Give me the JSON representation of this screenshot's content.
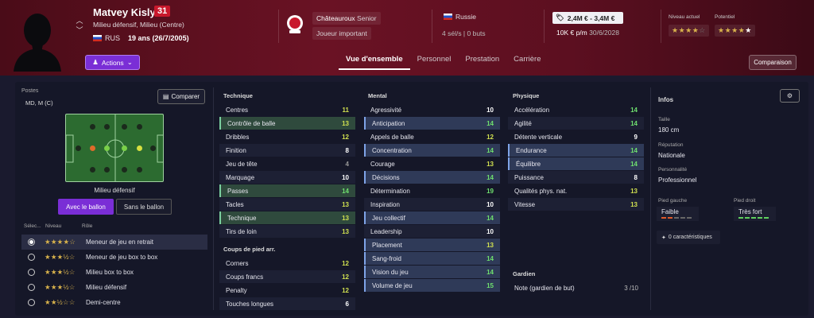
{
  "player": {
    "name": "Matvey Kislyak",
    "number": "31",
    "positions_desc": "Milieu défensif, Milieu (Centre)",
    "nationality_code": "RUS",
    "age_dob": "19 ans (26/7/2005)"
  },
  "header": {
    "actions_label": "Actions",
    "club": "Châteauroux",
    "squad": "Senior",
    "role": "Joueur important",
    "country": "Russie",
    "caps": "4 sél/s | 0 buts",
    "value_range": "2,4M € - 3,4M €",
    "wage": "10K € p/m",
    "contract_end": "30/6/2028",
    "current_level_label": "Niveau actuel",
    "potential_label": "Potentiel",
    "current_stars": 3.5,
    "potential_stars": 4.5,
    "compare_label": "Comparaison"
  },
  "tabs": [
    "Vue d'ensemble",
    "Personnel",
    "Prestation",
    "Carrière"
  ],
  "left": {
    "postes_label": "Postes",
    "positions": "MD, M (C)",
    "compare_label": "Comparer",
    "position_label": "Milieu défensif",
    "with_ball": "Avec le ballon",
    "without_ball": "Sans le ballon",
    "col_select": "Sélec...",
    "col_level": "Niveau",
    "col_role": "Rôle",
    "roles": [
      {
        "stars": "★★★★☆",
        "name": "Meneur de jeu en retrait",
        "selected": true
      },
      {
        "stars": "★★★½☆",
        "name": "Meneur de jeu box to box",
        "selected": false
      },
      {
        "stars": "★★★½☆",
        "name": "Milieu box to box",
        "selected": false
      },
      {
        "stars": "★★★½☆",
        "name": "Milieu défensif",
        "selected": false
      },
      {
        "stars": "★★½☆☆",
        "name": "Demi-centre",
        "selected": false
      }
    ]
  },
  "technique": {
    "title": "Technique",
    "attrs": [
      [
        "Centres",
        "11"
      ],
      [
        "Contrôle de balle",
        "13"
      ],
      [
        "Dribbles",
        "12"
      ],
      [
        "Finition",
        "8"
      ],
      [
        "Jeu de tête",
        "4"
      ],
      [
        "Marquage",
        "10"
      ],
      [
        "Passes",
        "14"
      ],
      [
        "Tacles",
        "13"
      ],
      [
        "Technique",
        "13"
      ],
      [
        "Tirs de loin",
        "13"
      ]
    ]
  },
  "setpieces": {
    "title": "Coups de pied arr.",
    "attrs": [
      [
        "Corners",
        "12"
      ],
      [
        "Coups francs",
        "12"
      ],
      [
        "Penalty",
        "12"
      ],
      [
        "Touches longues",
        "6"
      ]
    ]
  },
  "mental": {
    "title": "Mental",
    "attrs": [
      [
        "Agressivité",
        "10"
      ],
      [
        "Anticipation",
        "14"
      ],
      [
        "Appels de balle",
        "12"
      ],
      [
        "Concentration",
        "14"
      ],
      [
        "Courage",
        "13"
      ],
      [
        "Décisions",
        "14"
      ],
      [
        "Détermination",
        "19"
      ],
      [
        "Inspiration",
        "10"
      ],
      [
        "Jeu collectif",
        "14"
      ],
      [
        "Leadership",
        "10"
      ],
      [
        "Placement",
        "13"
      ],
      [
        "Sang-froid",
        "14"
      ],
      [
        "Vision du jeu",
        "14"
      ],
      [
        "Volume de jeu",
        "15"
      ]
    ]
  },
  "physique": {
    "title": "Physique",
    "attrs": [
      [
        "Accélération",
        "14"
      ],
      [
        "Agilité",
        "14"
      ],
      [
        "Détente verticale",
        "9"
      ],
      [
        "Endurance",
        "14"
      ],
      [
        "Équilibre",
        "14"
      ],
      [
        "Puissance",
        "8"
      ],
      [
        "Qualités phys. nat.",
        "13"
      ],
      [
        "Vitesse",
        "13"
      ]
    ]
  },
  "gardien": {
    "title": "Gardien",
    "label": "Note (gardien de but)",
    "value": "3 /10"
  },
  "infos": {
    "title": "Infos",
    "height_label": "Taille",
    "height": "180 cm",
    "reputation_label": "Réputation",
    "reputation": "Nationale",
    "personality_label": "Personnalité",
    "personality": "Professionnel",
    "left_foot_label": "Pied gauche",
    "left_foot": "Faible",
    "right_foot_label": "Pied droit",
    "right_foot": "Très fort",
    "traits": "0 caractéristiques"
  }
}
